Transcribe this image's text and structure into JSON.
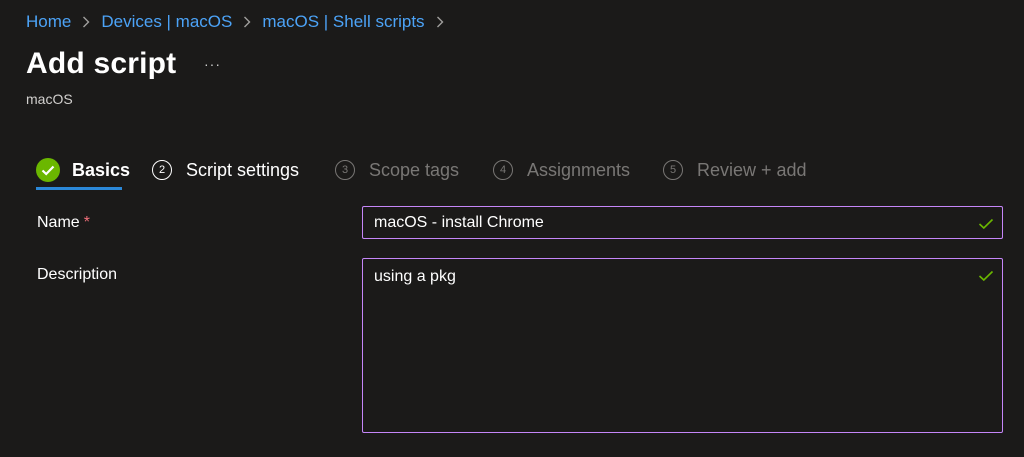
{
  "breadcrumb": {
    "items": [
      "Home",
      "Devices | macOS",
      "macOS | Shell scripts"
    ]
  },
  "header": {
    "title": "Add script",
    "more_label": "···",
    "subtitle": "macOS"
  },
  "wizard": {
    "tabs": [
      {
        "number": "",
        "label": "Basics",
        "state": "active-complete"
      },
      {
        "number": "2",
        "label": "Script settings",
        "state": "enabled"
      },
      {
        "number": "3",
        "label": "Scope tags",
        "state": "disabled"
      },
      {
        "number": "4",
        "label": "Assignments",
        "state": "disabled"
      },
      {
        "number": "5",
        "label": "Review + add",
        "state": "disabled"
      }
    ]
  },
  "form": {
    "name_label": "Name",
    "required_mark": "*",
    "name_value": "macOS - install Chrome",
    "description_label": "Description",
    "description_value": "using a pkg"
  },
  "colors": {
    "background": "#1b1a19",
    "link": "#4ca3f7",
    "focus_border": "#c586f8",
    "success": "#6bb700",
    "tab_underline": "#2b88d8",
    "required": "#f1707b"
  },
  "icons": {
    "breadcrumb_separator": "chevron-right-icon",
    "more": "more-horizontal-icon",
    "complete": "checkmark-circle-icon",
    "valid": "checkmark-icon"
  }
}
